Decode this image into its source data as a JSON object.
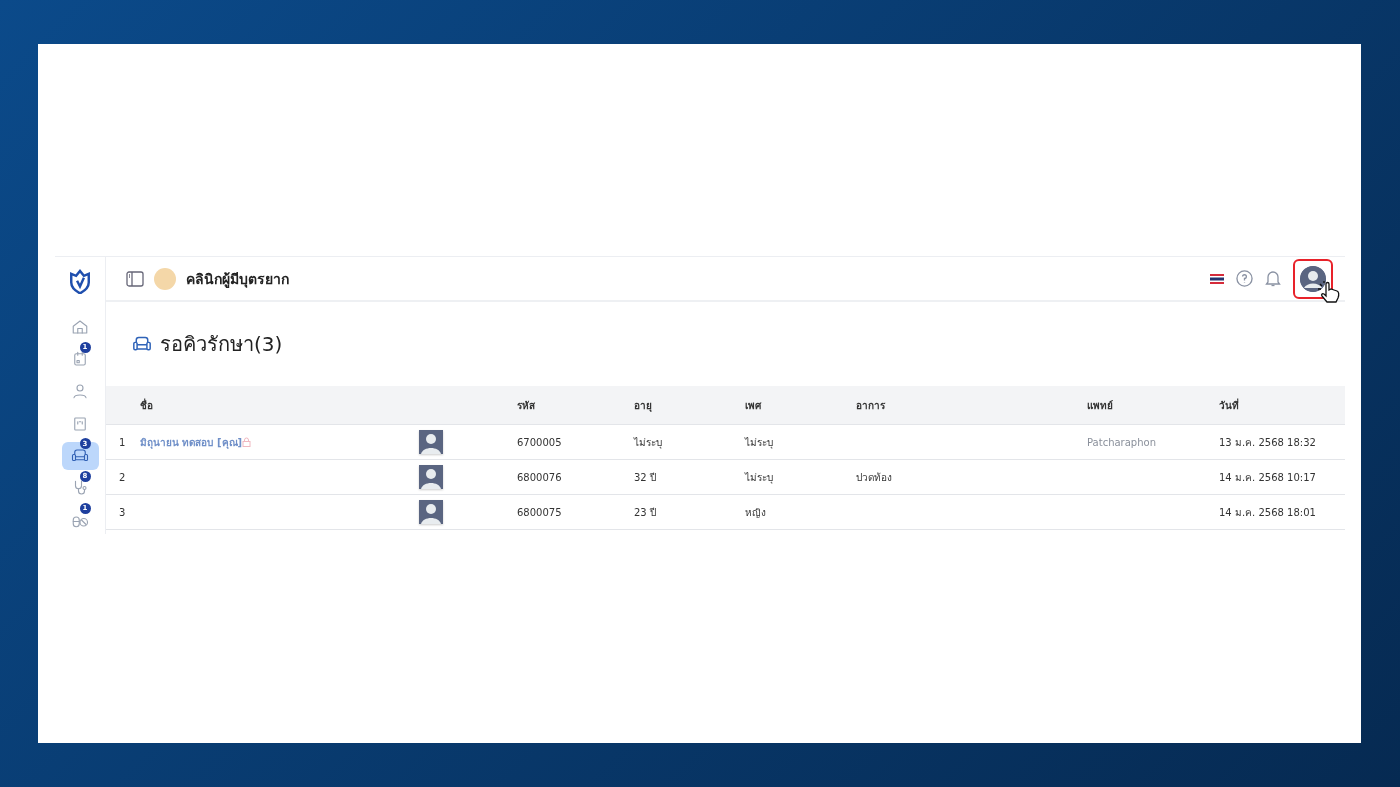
{
  "app": {
    "title": "คลินิกผู้มีบุตรยาก"
  },
  "topbar": {
    "profile_highlighted": true
  },
  "sidebar": {
    "items": [
      {
        "kind": "home",
        "selected": false
      },
      {
        "kind": "calendar",
        "badge": "1",
        "selected": false
      },
      {
        "kind": "person",
        "selected": false
      },
      {
        "kind": "card",
        "selected": false
      },
      {
        "kind": "sofa",
        "badge": "3",
        "selected": true
      },
      {
        "kind": "stethoscope",
        "badge": "8",
        "selected": false
      },
      {
        "kind": "pills",
        "badge": "1",
        "selected": false
      }
    ]
  },
  "page": {
    "heading": "รอคิวรักษา(3)"
  },
  "table": {
    "columns": [
      "ชื่อ",
      "รหัส",
      "อายุ",
      "เพศ",
      "อาการ",
      "แพทย์",
      "วันที่"
    ],
    "rows": [
      {
        "no": "1",
        "name": "มิถุนายน ทดสอบ [คุณ]",
        "locked": true,
        "code": "6700005",
        "age": "ไม่ระบุ",
        "sex": "ไม่ระบุ",
        "doctor": "Patcharaphon",
        "date": "13 ม.ค. 2568 18:32"
      },
      {
        "no": "2",
        "locked": false,
        "code": "6800076",
        "age": "32 ปี",
        "sex": "ไม่ระบุ",
        "symptom": "ปวดท้อง",
        "date": "14 ม.ค. 2568 10:17"
      },
      {
        "no": "3",
        "locked": false,
        "code": "6800075",
        "age": "23 ปี",
        "sex": "หญิง",
        "date": "14 ม.ค. 2568 18:01"
      }
    ]
  }
}
